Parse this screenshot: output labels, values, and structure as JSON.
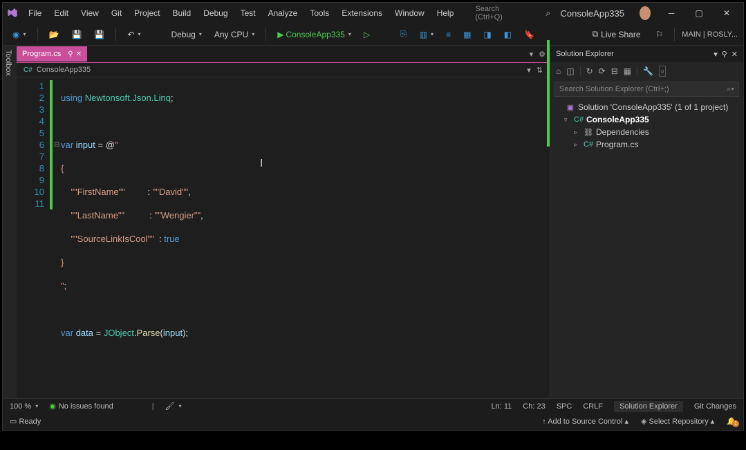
{
  "titlebar": {
    "menus": [
      "File",
      "Edit",
      "View",
      "Git",
      "Project",
      "Build",
      "Debug",
      "Test",
      "Analyze",
      "Tools",
      "Extensions",
      "Window",
      "Help"
    ],
    "search_placeholder": "Search (Ctrl+Q)",
    "app_title": "ConsoleApp335"
  },
  "toolbar": {
    "config": "Debug",
    "platform": "Any CPU",
    "run_label": "ConsoleApp335",
    "live_share": "Live Share",
    "branch_label": "MAIN | ROSLY..."
  },
  "toolbox_label": "Toolbox",
  "editor": {
    "tab_label": "Program.cs",
    "breadcrumb": "ConsoleApp335",
    "line_numbers": [
      "1",
      "2",
      "3",
      "4",
      "5",
      "6",
      "7",
      "8",
      "9",
      "10",
      "11"
    ],
    "code": {
      "l1": {
        "kw": "using",
        "ns": "Newtonsoft.Json.Linq"
      },
      "l3": {
        "kw": "var",
        "ident": "input",
        "op": "= @",
        "str": "\""
      },
      "l4": "{",
      "l5": {
        "k": "\"\"FirstName\"\"",
        "v": "\"\"David\"\""
      },
      "l6": {
        "k": "\"\"LastName\"\"",
        "v": "\"\"Wengier\"\""
      },
      "l7": {
        "k": "\"\"SourceLinkIsCool\"\"",
        "v": "true"
      },
      "l8": "}",
      "l9": "\";",
      "l11": {
        "kw": "var",
        "ident": "data",
        "eq": "= ",
        "cls": "JObject",
        "mth": "Parse",
        "arg": "input"
      }
    }
  },
  "solution": {
    "title": "Solution Explorer",
    "search_placeholder": "Search Solution Explorer (Ctrl+;)",
    "root": "Solution 'ConsoleApp335' (1 of 1 project)",
    "project": "ConsoleApp335",
    "deps": "Dependencies",
    "file": "Program.cs"
  },
  "status": {
    "zoom": "100 %",
    "issues": "No issues found",
    "line": "Ln: 11",
    "col": "Ch: 23",
    "spc": "SPC",
    "crlf": "CRLF",
    "tab1": "Solution Explorer",
    "tab2": "Git Changes"
  },
  "footer": {
    "ready": "Ready",
    "source_control": "Add to Source Control",
    "repo": "Select Repository"
  }
}
